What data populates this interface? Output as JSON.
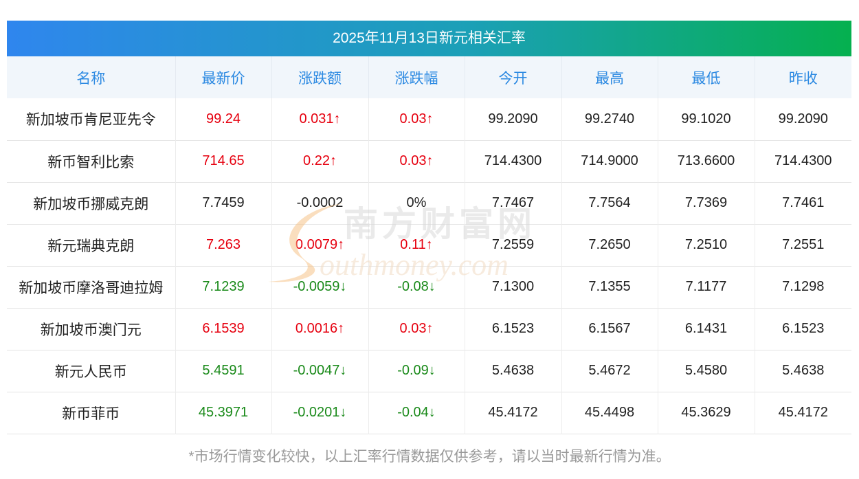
{
  "title": "2025年11月13日新元相关汇率",
  "headers": [
    "名称",
    "最新价",
    "涨跌额",
    "涨跌幅",
    "今开",
    "最高",
    "最低",
    "昨收"
  ],
  "rows": [
    {
      "name": "新加坡币肯尼亚先令",
      "latest": "99.24",
      "change": "0.031↑",
      "pct": "0.03↑",
      "open": "99.2090",
      "high": "99.2740",
      "low": "99.1020",
      "prev": "99.2090",
      "trend": "up"
    },
    {
      "name": "新币智利比索",
      "latest": "714.65",
      "change": "0.22↑",
      "pct": "0.03↑",
      "open": "714.4300",
      "high": "714.9000",
      "low": "713.6600",
      "prev": "714.4300",
      "trend": "up"
    },
    {
      "name": "新加坡币挪威克朗",
      "latest": "7.7459",
      "change": "-0.0002",
      "pct": "0%",
      "open": "7.7467",
      "high": "7.7564",
      "low": "7.7369",
      "prev": "7.7461",
      "trend": "flat"
    },
    {
      "name": "新元瑞典克朗",
      "latest": "7.263",
      "change": "0.0079↑",
      "pct": "0.11↑",
      "open": "7.2559",
      "high": "7.2650",
      "low": "7.2510",
      "prev": "7.2551",
      "trend": "up"
    },
    {
      "name": "新加坡币摩洛哥迪拉姆",
      "latest": "7.1239",
      "change": "-0.0059↓",
      "pct": "-0.08↓",
      "open": "7.1300",
      "high": "7.1355",
      "low": "7.1177",
      "prev": "7.1298",
      "trend": "down"
    },
    {
      "name": "新加坡币澳门元",
      "latest": "6.1539",
      "change": "0.0016↑",
      "pct": "0.03↑",
      "open": "6.1523",
      "high": "6.1567",
      "low": "6.1431",
      "prev": "6.1523",
      "trend": "up"
    },
    {
      "name": "新元人民币",
      "latest": "5.4591",
      "change": "-0.0047↓",
      "pct": "-0.09↓",
      "open": "5.4638",
      "high": "5.4672",
      "low": "5.4580",
      "prev": "5.4638",
      "trend": "down"
    },
    {
      "name": "新币菲币",
      "latest": "45.3971",
      "change": "-0.0201↓",
      "pct": "-0.04↓",
      "open": "45.4172",
      "high": "45.4498",
      "low": "45.3629",
      "prev": "45.4172",
      "trend": "down"
    }
  ],
  "watermark": {
    "cn": "南方财富网",
    "en": "outhmoney.com"
  },
  "note": "*市场行情变化较快，以上汇率行情数据仅供参考，请以当时最新行情为准。",
  "colors": {
    "up": "#e6000f",
    "down": "#1a8a1a",
    "header_text": "#2d8ae2",
    "title_start": "#2f86ee",
    "title_end": "#05b04f"
  }
}
